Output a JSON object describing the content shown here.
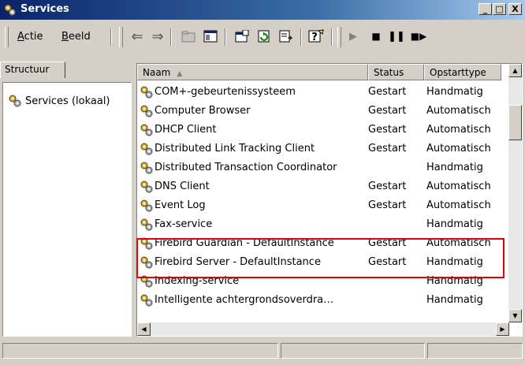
{
  "window": {
    "title": "Services",
    "buttons": {
      "minimize": "_",
      "maximize": "□",
      "close": "X"
    }
  },
  "menu": {
    "actie": "Actie",
    "beeld": "Beeld"
  },
  "toolbar": {
    "icons": [
      "back-arrow-icon",
      "forward-arrow-icon",
      "up-folder-icon",
      "show-tree-icon",
      "properties-icon",
      "refresh-icon",
      "export-list-icon",
      "help-icon",
      "start-service-icon",
      "stop-service-icon",
      "pause-service-icon",
      "restart-service-icon"
    ]
  },
  "left_pane": {
    "tab": "Structuur",
    "tree_item": "Services (lokaal)"
  },
  "columns": {
    "name": "Naam",
    "status": "Status",
    "startup": "Opstarttype"
  },
  "services": [
    {
      "name": "COM+-gebeurtenissysteem",
      "status": "Gestart",
      "startup": "Handmatig"
    },
    {
      "name": "Computer Browser",
      "status": "Gestart",
      "startup": "Automatisch"
    },
    {
      "name": "DHCP Client",
      "status": "Gestart",
      "startup": "Automatisch"
    },
    {
      "name": "Distributed Link Tracking Client",
      "status": "Gestart",
      "startup": "Automatisch"
    },
    {
      "name": "Distributed Transaction Coordinator",
      "status": "",
      "startup": "Handmatig"
    },
    {
      "name": "DNS Client",
      "status": "Gestart",
      "startup": "Automatisch"
    },
    {
      "name": "Event Log",
      "status": "Gestart",
      "startup": "Automatisch"
    },
    {
      "name": "Fax-service",
      "status": "",
      "startup": "Handmatig"
    },
    {
      "name": "Firebird Guardian - DefaultInstance",
      "status": "Gestart",
      "startup": "Automatisch"
    },
    {
      "name": "Firebird Server - DefaultInstance",
      "status": "Gestart",
      "startup": "Handmatig"
    },
    {
      "name": "Indexing-service",
      "status": "",
      "startup": "Handmatig"
    },
    {
      "name": "Intelligente achtergrondsoverdra…",
      "status": "",
      "startup": "Handmatig"
    }
  ],
  "colors": {
    "title_bar": "#0a246a",
    "highlight_border": "#e00000",
    "chrome": "#d4d0c8"
  }
}
